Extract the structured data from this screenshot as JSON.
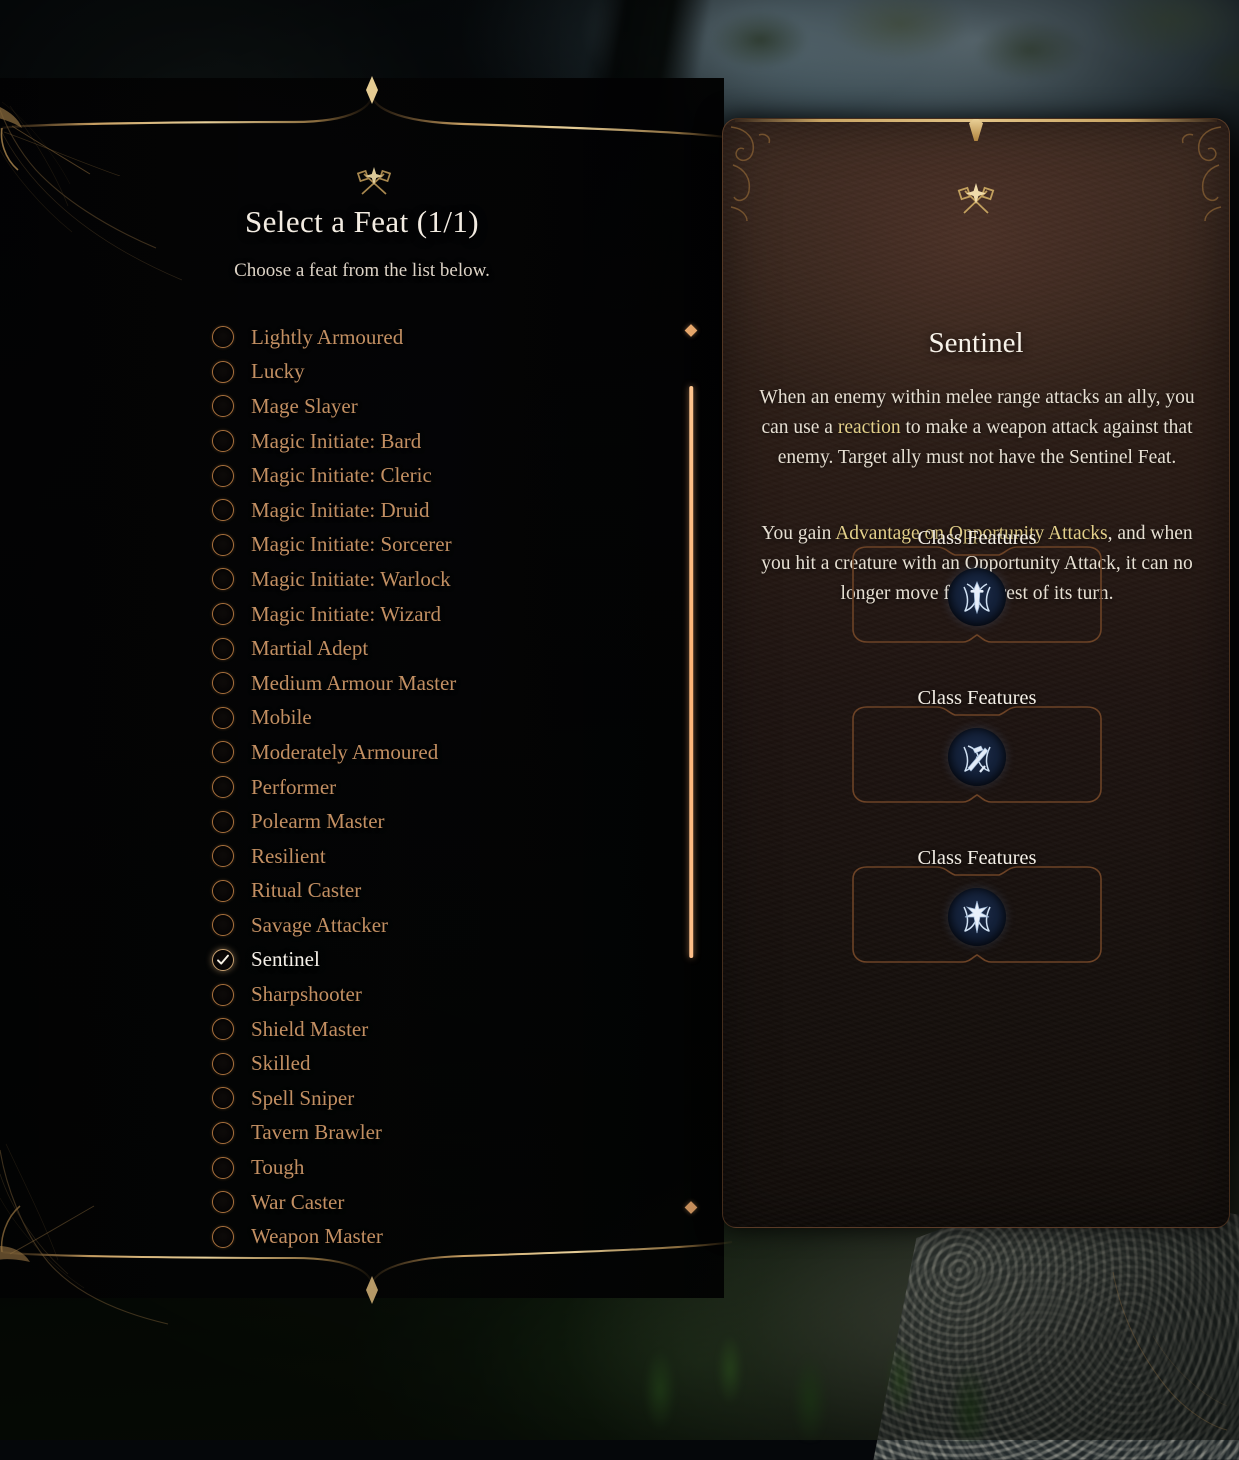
{
  "window": {
    "title": "Select a Feat (1/1)",
    "subtitle": "Choose a feat from the list below."
  },
  "colors": {
    "accent_copper": "#c28f62",
    "accent_gold": "#e3d08a",
    "selected_text": "#f6f1e9",
    "scrollbar": "#ffb577",
    "panel_brown": "#2c1d16",
    "ring": "#a9713d"
  },
  "feat_list": {
    "name": "feat-list",
    "selected_index": 18,
    "items": [
      {
        "label": "Lightly Armoured",
        "selected": false
      },
      {
        "label": "Lucky",
        "selected": false
      },
      {
        "label": "Mage Slayer",
        "selected": false
      },
      {
        "label": "Magic Initiate: Bard",
        "selected": false
      },
      {
        "label": "Magic Initiate: Cleric",
        "selected": false
      },
      {
        "label": "Magic Initiate: Druid",
        "selected": false
      },
      {
        "label": "Magic Initiate: Sorcerer",
        "selected": false
      },
      {
        "label": "Magic Initiate: Warlock",
        "selected": false
      },
      {
        "label": "Magic Initiate: Wizard",
        "selected": false
      },
      {
        "label": "Martial Adept",
        "selected": false
      },
      {
        "label": "Medium Armour Master",
        "selected": false
      },
      {
        "label": "Mobile",
        "selected": false
      },
      {
        "label": "Moderately Armoured",
        "selected": false
      },
      {
        "label": "Performer",
        "selected": false
      },
      {
        "label": "Polearm Master",
        "selected": false
      },
      {
        "label": "Resilient",
        "selected": false
      },
      {
        "label": "Ritual Caster",
        "selected": false
      },
      {
        "label": "Savage Attacker",
        "selected": false
      },
      {
        "label": "Sentinel",
        "selected": true
      },
      {
        "label": "Sharpshooter",
        "selected": false
      },
      {
        "label": "Shield Master",
        "selected": false
      },
      {
        "label": "Skilled",
        "selected": false
      },
      {
        "label": "Spell Sniper",
        "selected": false
      },
      {
        "label": "Tavern Brawler",
        "selected": false
      },
      {
        "label": "Tough",
        "selected": false
      },
      {
        "label": "War Caster",
        "selected": false
      },
      {
        "label": "Weapon Master",
        "selected": false
      }
    ]
  },
  "detail_panel": {
    "emblem_icon": "crossed-axe-emblem-icon",
    "title": "Sentinel",
    "paragraph_1_parts": [
      {
        "text": "When an enemy within melee range attacks an ally, you can use a ",
        "highlight": false
      },
      {
        "text": "reaction",
        "highlight": true
      },
      {
        "text": " to make a weapon attack against that enemy. Target ally must not have the Sentinel Feat.",
        "highlight": false
      }
    ],
    "paragraph_2_parts": [
      {
        "text": "You gain ",
        "highlight": false
      },
      {
        "text": "Advantage on Opportunity Attacks",
        "highlight": true
      },
      {
        "text": ", and when you hit a creature with an Opportunity Attack, it can no longer move for the rest of its turn.",
        "highlight": false
      }
    ],
    "class_feature_cards": [
      {
        "title": "Class Features",
        "icon": "sword-wings-crest-icon"
      },
      {
        "title": "Class Features",
        "icon": "crossed-blades-crest-icon"
      },
      {
        "title": "Class Features",
        "icon": "radiant-sword-crest-icon"
      }
    ]
  },
  "scrollbar": {
    "name": "feat-list-scrollbar",
    "top_marker_icon": "diamond-marker-icon",
    "bottom_marker_icon": "diamond-marker-icon"
  }
}
